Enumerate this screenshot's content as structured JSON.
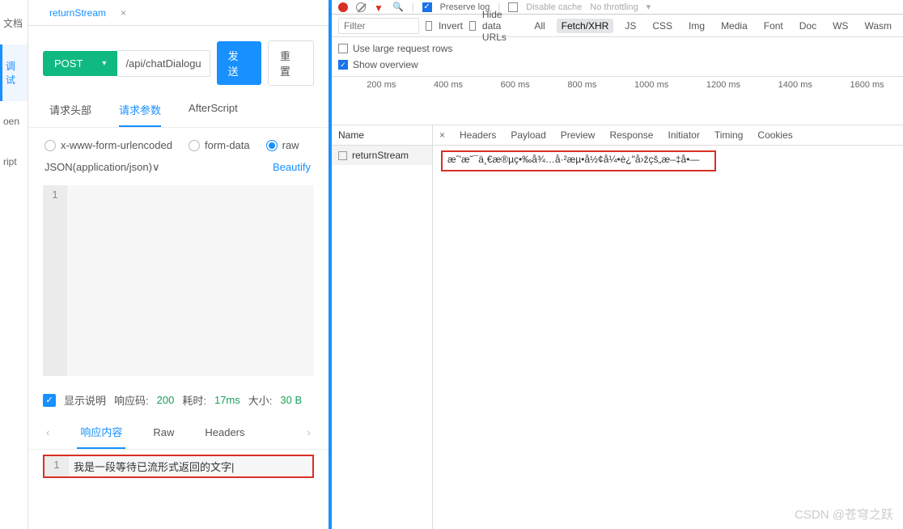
{
  "leftnav": {
    "item0": "文档",
    "item1": "调试",
    "item2": "oen",
    "item3": "ript"
  },
  "tabs": {
    "title": "returnStream",
    "close": "×"
  },
  "request": {
    "method": "POST",
    "url": "/api/chatDialogu",
    "send": "发 送",
    "reset": "重 置"
  },
  "subtabs": {
    "t0": "请求头部",
    "t1": "请求参数",
    "t2": "AfterScript"
  },
  "bodytype": {
    "b0": "x-www-form-urlencoded",
    "b1": "form-data",
    "b2": "raw"
  },
  "json": {
    "label": "JSON(application/json)∨",
    "beautify": "Beautify"
  },
  "editor": {
    "ln": "1",
    "content": ""
  },
  "respinfo": {
    "show": "显示说明",
    "code_lbl": "响应码:",
    "code": "200",
    "time_lbl": "耗时:",
    "time": "17ms",
    "size_lbl": "大小:",
    "size": "30 B"
  },
  "rtabs": {
    "t0": "响应内容",
    "t1": "Raw",
    "t2": "Headers"
  },
  "resp": {
    "ln": "1",
    "text": "我是一段等待已流形式返回的文字|"
  },
  "dt": {
    "preserve": "Preserve log",
    "disable": "Disable cache",
    "throttle": "No throttling",
    "filter_ph": "Filter",
    "invert": "Invert",
    "hide": "Hide data URLs",
    "all": "All",
    "fetch": "Fetch/XHR",
    "js": "JS",
    "css": "CSS",
    "img": "Img",
    "media": "Media",
    "font": "Font",
    "doc": "Doc",
    "ws": "WS",
    "wasm": "Wasm",
    "large": "Use large request rows",
    "overview": "Show overview",
    "ticks": [
      "200 ms",
      "400 ms",
      "600 ms",
      "800 ms",
      "1000 ms",
      "1200 ms",
      "1400 ms",
      "1600 ms"
    ],
    "name_hdr": "Name",
    "row0": "returnStream",
    "dtabs": [
      "Headers",
      "Payload",
      "Preview",
      "Response",
      "Initiator",
      "Timing",
      "Cookies"
    ],
    "respbody": "æˆ'æ˜¯ä¸€æ®µç•‰å¾…å·²æµ•å½¢å¼•è¿\"å›žçš„æ–‡å•—"
  },
  "watermark": "CSDN @苍穹之跃"
}
